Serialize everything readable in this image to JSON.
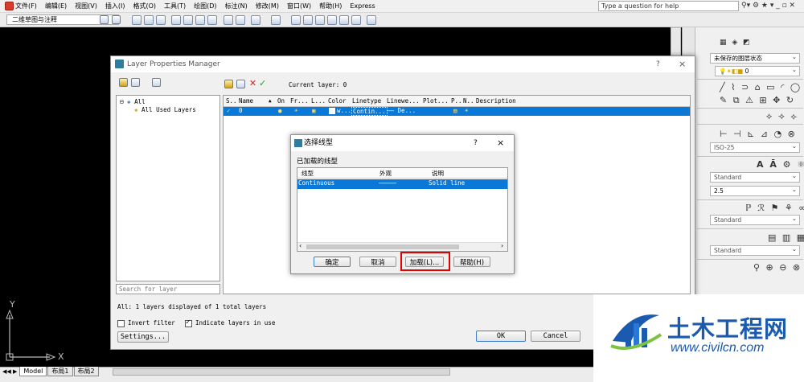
{
  "menu": [
    "文件(F)",
    "编辑(E)",
    "视图(V)",
    "插入(I)",
    "格式(O)",
    "工具(T)",
    "绘图(D)",
    "标注(N)",
    "修改(M)",
    "窗口(W)",
    "帮助(H)",
    "Express"
  ],
  "workspace": "二维草图与注释",
  "help_placeholder": "Type a question for help",
  "right_panel": {
    "layer_state": "未保存的图层状态",
    "layer_current": "0",
    "dim_style": "ISO-25",
    "text_style": "Standard",
    "text_height": "2.5",
    "mleader_style": "Standard",
    "table_style": "Standard"
  },
  "lpm": {
    "title": "Layer Properties Manager",
    "help": "?",
    "close": "×",
    "current_layer_label": "Current layer: 0",
    "tree_root": "All",
    "tree_child": "All Used Layers",
    "columns": [
      "S..",
      "Name",
      "On",
      "Fr...",
      "L...",
      "Color",
      "Linetype",
      "Linewe...",
      "Plot...",
      "P..",
      "N..",
      "Description"
    ],
    "row": {
      "status": "✓",
      "name": "0",
      "color": "w...",
      "linetype": "Contin...",
      "lineweight": "—— De..."
    },
    "search_placeholder": "Search for layer",
    "status_text": "All: 1 layers displayed of 1 total layers",
    "invert_filter": "Invert filter",
    "indicate_used": "Indicate layers in use",
    "settings_button": "Settings...",
    "ok_button": "OK",
    "cancel_button": "Cancel"
  },
  "select_linetype": {
    "title": "选择线型",
    "help": "?",
    "close": "×",
    "loaded_label": "已加载的线型",
    "headers": [
      "线型",
      "外观",
      "说明"
    ],
    "row": {
      "linetype": "Continuous",
      "appearance": "————————",
      "description": "Solid line"
    },
    "ok": "确定",
    "cancel": "取消",
    "load": "加载(L)...",
    "help_btn": "帮助(H)"
  },
  "tabs": [
    "Model",
    "布局1",
    "布局2"
  ],
  "axis": {
    "x": "X",
    "y": "Y"
  },
  "watermark": {
    "name": "土木工程网",
    "url": "www.civilcn.com"
  },
  "colors": {
    "selection": "#0a78d7",
    "highlight": "#e60000",
    "logo_blue": "#1a5bb0"
  }
}
